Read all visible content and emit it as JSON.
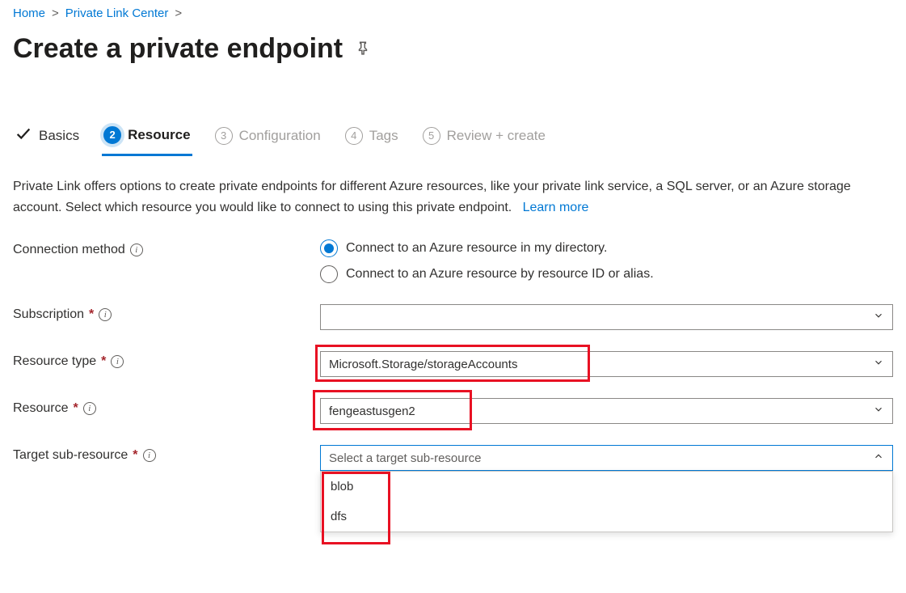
{
  "breadcrumbs": {
    "home": "Home",
    "section": "Private Link Center"
  },
  "page": {
    "title": "Create a private endpoint"
  },
  "tabs": [
    {
      "label": "Basics"
    },
    {
      "label": "Resource",
      "number": "2"
    },
    {
      "label": "Configuration",
      "number": "3"
    },
    {
      "label": "Tags",
      "number": "4"
    },
    {
      "label": "Review + create",
      "number": "5"
    }
  ],
  "description": {
    "text": "Private Link offers options to create private endpoints for different Azure resources, like your private link service, a SQL server, or an Azure storage account. Select which resource you would like to connect to using this private endpoint.",
    "learn_more": "Learn more"
  },
  "connection_method": {
    "label": "Connection method",
    "options": [
      "Connect to an Azure resource in my directory.",
      "Connect to an Azure resource by resource ID or alias."
    ]
  },
  "subscription": {
    "label": "Subscription",
    "value": ""
  },
  "resource_type": {
    "label": "Resource type",
    "value": "Microsoft.Storage/storageAccounts"
  },
  "resource": {
    "label": "Resource",
    "value": "fengeastusgen2"
  },
  "target_sub_resource": {
    "label": "Target sub-resource",
    "placeholder": "Select a target sub-resource",
    "options": [
      "blob",
      "dfs"
    ]
  }
}
